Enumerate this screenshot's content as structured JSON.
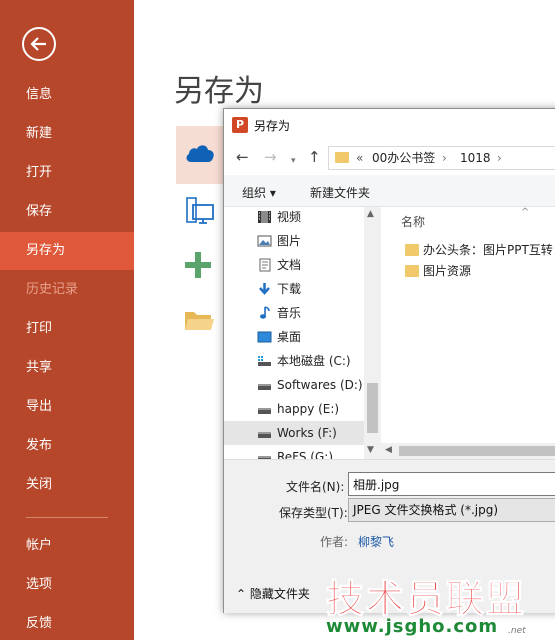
{
  "colors": {
    "nav_bg": "#b7472a",
    "nav_active": "#e0583a",
    "onedrive_highlight": "#f6ddd3",
    "link": "#1e5aa8",
    "watermark_red": "#ea3a3a",
    "watermark_green": "#1e8a37"
  },
  "nav": {
    "back_icon": "back-arrow-icon",
    "items": [
      {
        "label": "信息"
      },
      {
        "label": "新建"
      },
      {
        "label": "打开"
      },
      {
        "label": "保存"
      },
      {
        "label": "另存为"
      },
      {
        "label": "历史记录"
      },
      {
        "label": "打印"
      },
      {
        "label": "共享"
      },
      {
        "label": "导出"
      },
      {
        "label": "发布"
      },
      {
        "label": "关闭"
      },
      {
        "label": "帐户"
      },
      {
        "label": "选项"
      },
      {
        "label": "反馈"
      }
    ]
  },
  "main": {
    "title": "另存为",
    "locations": [
      {
        "icon": "onedrive-cloud-icon"
      },
      {
        "icon": "this-pc-icon"
      },
      {
        "icon": "add-place-icon"
      },
      {
        "icon": "browse-folder-icon"
      }
    ]
  },
  "dialog": {
    "title": "另存为",
    "address": {
      "prefix": "«",
      "segments": [
        "00办公书签",
        "1018"
      ],
      "separator": "›"
    },
    "toolbar": {
      "organize": "组织 ▾",
      "new_folder": "新建文件夹"
    },
    "tree": [
      {
        "label": "视频",
        "icon": "video-folder-icon"
      },
      {
        "label": "图片",
        "icon": "pictures-folder-icon"
      },
      {
        "label": "文档",
        "icon": "documents-folder-icon"
      },
      {
        "label": "下载",
        "icon": "downloads-icon"
      },
      {
        "label": "音乐",
        "icon": "music-icon"
      },
      {
        "label": "桌面",
        "icon": "desktop-icon"
      },
      {
        "label": "本地磁盘 (C:)",
        "icon": "system-drive-icon"
      },
      {
        "label": "Softwares (D:)",
        "icon": "drive-icon"
      },
      {
        "label": "happy (E:)",
        "icon": "drive-icon"
      },
      {
        "label": "Works (F:)",
        "icon": "drive-icon"
      },
      {
        "label": "ReFS (G:)",
        "icon": "drive-icon"
      }
    ],
    "files": {
      "column_name": "名称",
      "items": [
        {
          "label": "办公头条：图片PPT互转"
        },
        {
          "label": "图片资源"
        }
      ]
    },
    "form": {
      "filename_label": "文件名(N):",
      "filename_value": "相册.jpg",
      "type_label": "保存类型(T):",
      "type_value": "JPEG 文件交换格式 (*.jpg)",
      "author_label": "作者:",
      "author_value": "柳黎飞"
    },
    "footer": {
      "hide_folders": "隐藏文件夹"
    }
  },
  "watermark": {
    "main": "技术员联盟",
    "url": "www.jsgho.com",
    "suffix": ".net"
  }
}
